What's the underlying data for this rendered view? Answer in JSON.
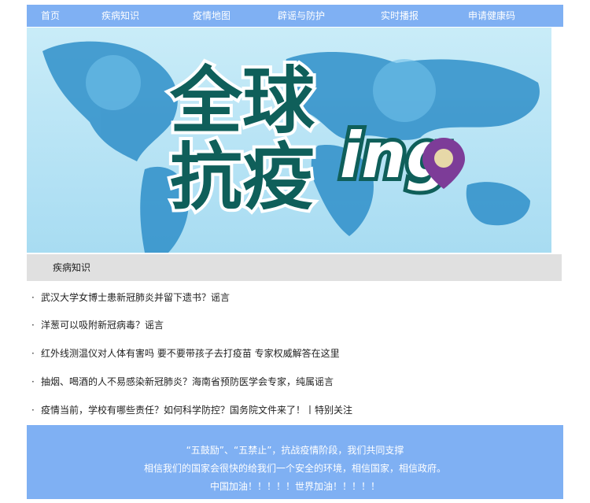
{
  "nav": {
    "items": [
      "首页",
      "疾病知识",
      "疫情地图",
      "辟谣与防护",
      "实时播报",
      "申请健康码"
    ]
  },
  "banner": {
    "title_line1": "全球",
    "title_line2": "抗疫",
    "title_suffix": "ing"
  },
  "section": {
    "title": "疾病知识"
  },
  "news": {
    "bullet": "·",
    "items": [
      "武汉大学女博士患新冠肺炎并留下遗书？谣言",
      "洋葱可以吸附新冠病毒？谣言",
      "红外线测温仪对人体有害吗  要不要带孩子去打疫苗  专家权威解答在这里",
      "抽烟、喝酒的人不易感染新冠肺炎？海南省预防医学会专家，纯属谣言",
      "疫情当前，学校有哪些责任？如何科学防控？国务院文件来了！丨特别关注"
    ]
  },
  "footer": {
    "line1": "“五鼓励”、“五禁止”，抗战疫情阶段，我们共同支撑",
    "line2": "相信我们的国家会很快的给我们一个安全的环境，相信国家，相信政府。",
    "line3": "中国加油！！！！！世界加油！！！！！"
  },
  "colors": {
    "nav_bg": "#7fb0f3",
    "footer_bg": "#7fb0f3",
    "section_bg": "#e0e0e0",
    "banner_text": "#0f5f5a"
  }
}
